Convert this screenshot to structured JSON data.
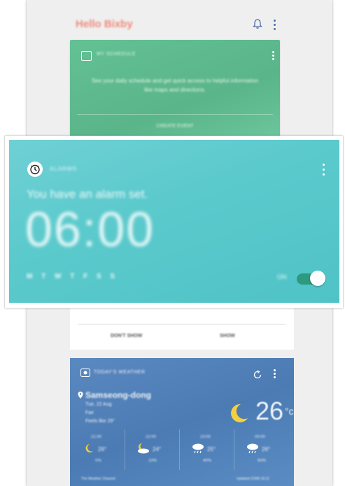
{
  "app": {
    "title": "Hello Bixby"
  },
  "schedule_card": {
    "title": "MY SCHEDULE",
    "body": "See your daily schedule and get quick access to helpful information like maps and directions.",
    "button": "CREATE EVENT"
  },
  "alarm_card": {
    "title": "ALARMS",
    "subtitle": "You have an alarm set.",
    "time": "06:00",
    "days": "M T W T F S S",
    "state_label": "ON",
    "enabled": true
  },
  "mid_card": {
    "left_button": "DON'T SHOW",
    "right_button": "SHOW"
  },
  "weather_card": {
    "title": "TODAY'S WEATHER",
    "location": "Samseong-dong",
    "date": "Tue, 22 Aug",
    "condition": "Fair",
    "feels_like": "Feels like 29°",
    "temperature": "26",
    "unit": "°c",
    "forecast": [
      {
        "time": "21:00",
        "temp": "26°",
        "precip": "0%"
      },
      {
        "time": "22:00",
        "temp": "24°",
        "precip": "10%"
      },
      {
        "time": "23:00",
        "temp": "25°",
        "precip": "40%"
      },
      {
        "time": "00:00",
        "temp": "26°",
        "precip": "60%"
      }
    ],
    "source": "The Weather Channel",
    "updated": "Updated 22/08 19:12"
  },
  "colors": {
    "alarm_bg": "#5ccacd",
    "schedule_bg": "#5ab58a",
    "weather_bg": "#4c7bb4",
    "toggle_on": "#2c9a7e"
  }
}
